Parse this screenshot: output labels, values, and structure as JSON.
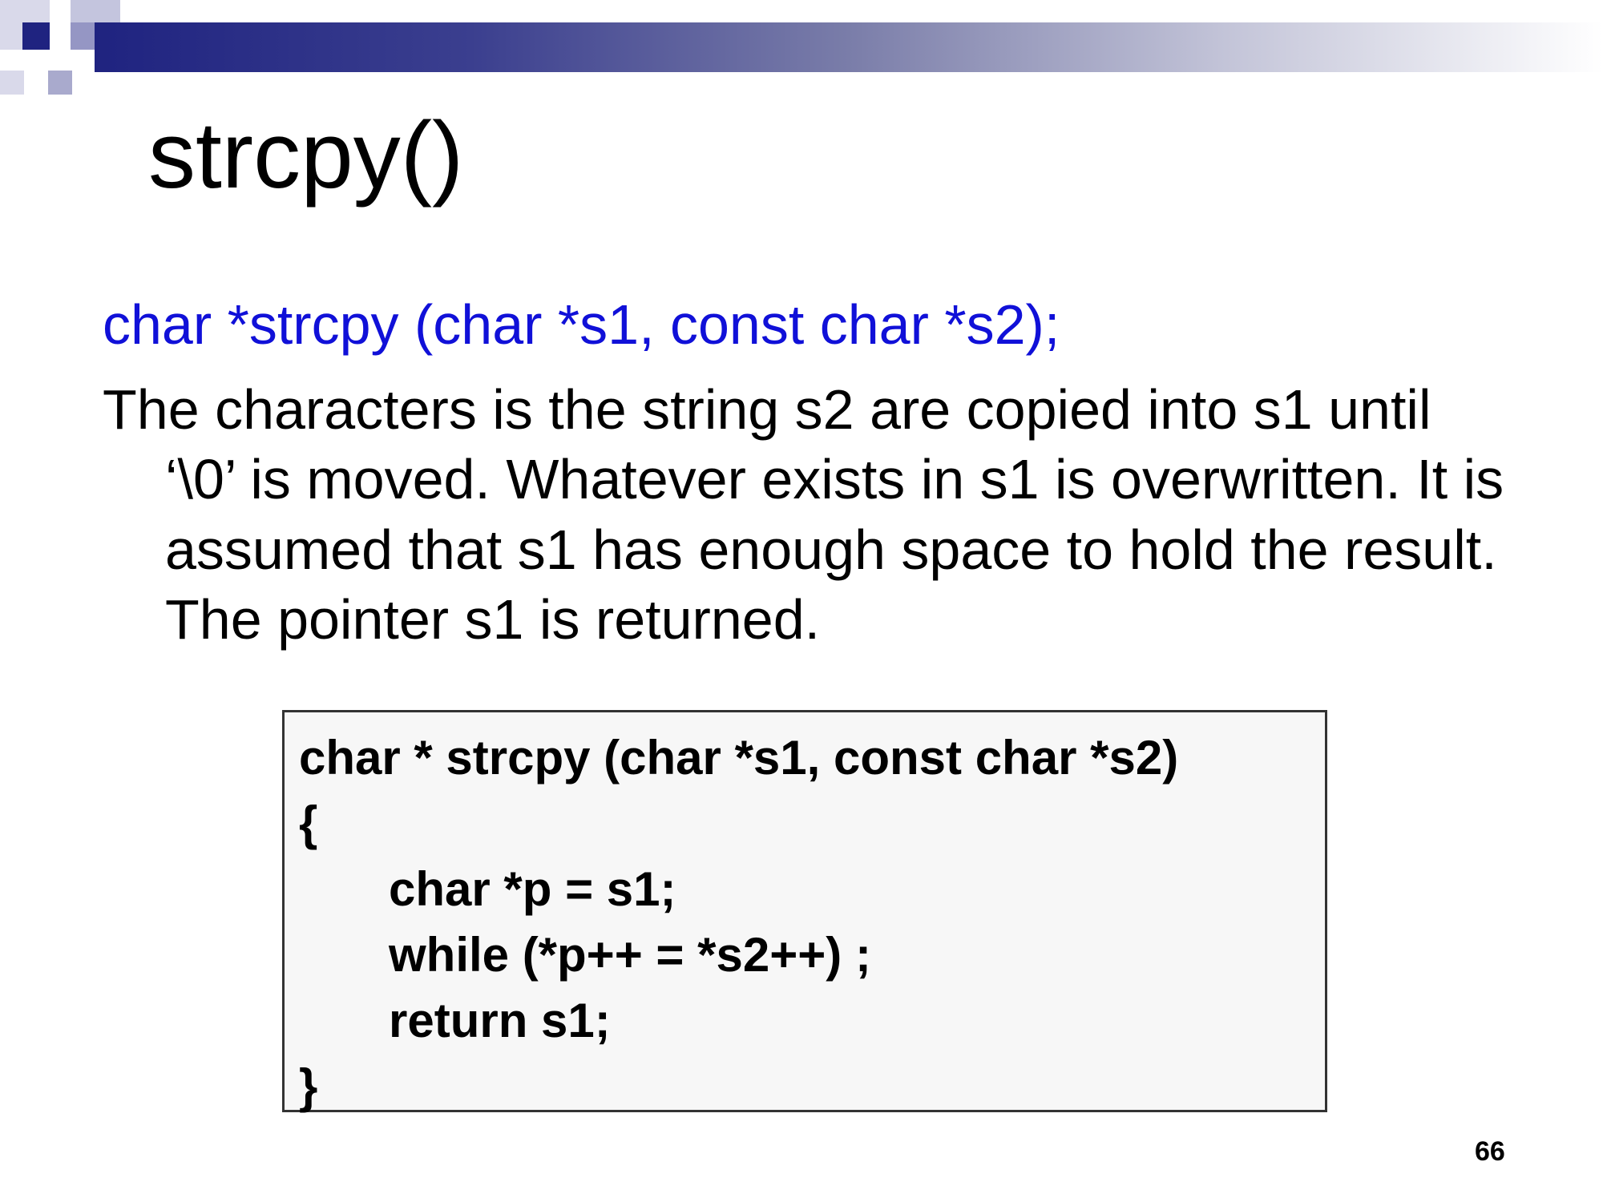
{
  "slide": {
    "title": "strcpy()",
    "signature": "char *strcpy (char *s1, const char *s2);",
    "description": "The characters is the string s2 are copied into s1 until ‘\\0’ is moved. Whatever exists in s1 is overwritten. It is assumed that s1 has enough space to hold the result. The pointer s1 is returned.",
    "code": {
      "line1": "char * strcpy (char *s1, const char *s2)",
      "line2": "{",
      "line3": "char *p = s1;",
      "line4": "while (*p++ = *s2++) ;",
      "line5": "return s1;",
      "line6": "}"
    },
    "page_number": "66"
  },
  "colors": {
    "signature": "#1010d8",
    "header_dark": "#1f2380"
  }
}
